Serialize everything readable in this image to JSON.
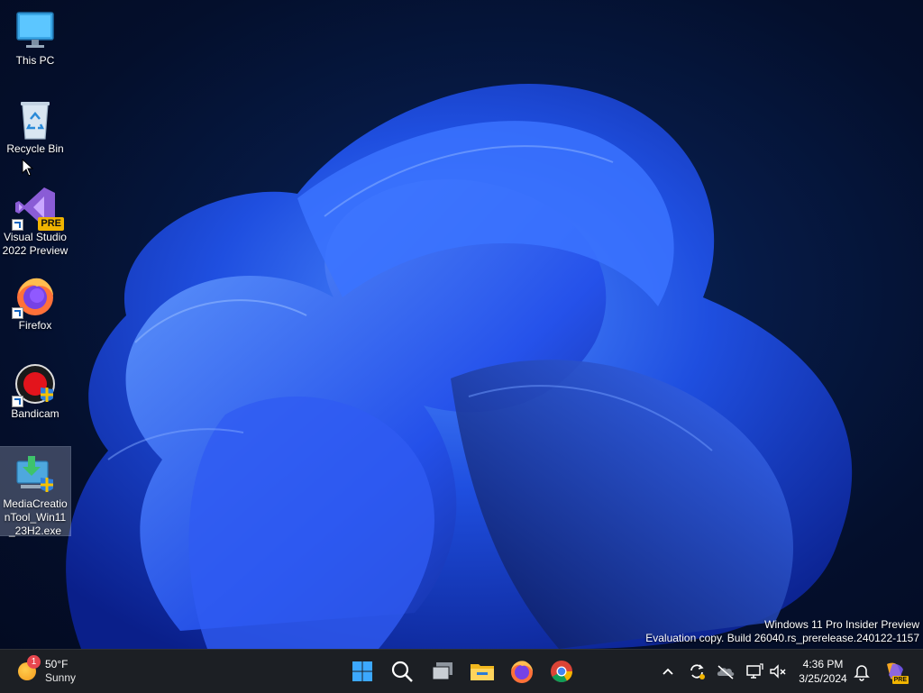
{
  "desktop": {
    "icons": [
      {
        "label": "This PC",
        "icon": "monitor-icon"
      },
      {
        "label": "Recycle Bin",
        "icon": "recycle-bin-icon"
      },
      {
        "label": "Visual Studio 2022 Preview",
        "icon": "visual-studio-icon",
        "badge": "PRE"
      },
      {
        "label": "Firefox",
        "icon": "firefox-icon"
      },
      {
        "label": "Bandicam",
        "icon": "bandicam-icon"
      },
      {
        "label": "MediaCreationTool_Win11_23H2.exe",
        "icon": "media-creation-tool-icon",
        "selected": true
      }
    ],
    "watermark": {
      "line1": "Windows 11 Pro Insider Preview",
      "line2": "Evaluation copy. Build 26040.rs_prerelease.240122-1157"
    }
  },
  "taskbar": {
    "weather": {
      "temp": "50°F",
      "condition": "Sunny",
      "badge": "1"
    },
    "pinned": [
      "start-icon",
      "search-icon",
      "task-view-icon",
      "file-explorer-icon",
      "firefox-icon",
      "chrome-icon"
    ],
    "tray": [
      "chevron-up-icon",
      "sync-icon",
      "onedrive-offline-icon",
      "network-icon",
      "volume-muted-icon"
    ],
    "clock": {
      "time": "4:36 PM",
      "date": "3/25/2024"
    },
    "copilot_badge": "PRE"
  },
  "colors": {
    "taskbar": "#1c1f24",
    "accent": "#1e5fff",
    "bloom": "#2a55ff"
  }
}
